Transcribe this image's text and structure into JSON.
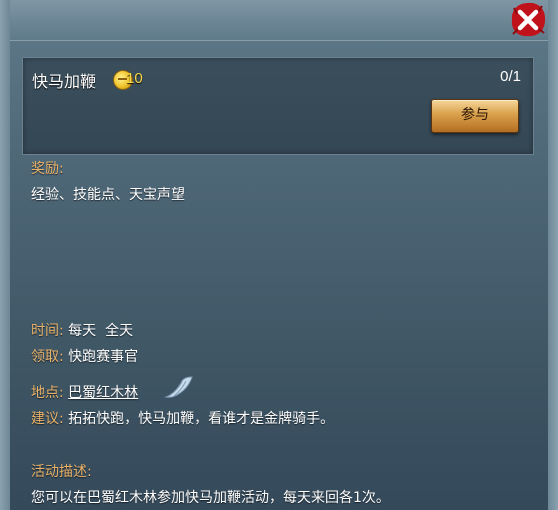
{
  "window": {
    "close_icon": "close-x-icon"
  },
  "quest": {
    "title": "快马加鞭",
    "reward_icon": "coin-icon",
    "reward_count": "10",
    "progress": "0/1",
    "join_label": "参与"
  },
  "reward": {
    "label": "奖励:",
    "items": "经验、技能点、天宝声望"
  },
  "info": {
    "time_label": "时间:",
    "time_value": "每天  全天",
    "receive_label": "领取:",
    "receive_value": "快跑赛事官",
    "location_label": "地点:",
    "location_value": "巴蜀红木林",
    "location_icon": "wing-travel-icon",
    "advice_label": "建议:",
    "advice_value": "拓拓快跑，快马加鞭，看谁才是金牌骑手。"
  },
  "description": {
    "label": "活动描述:",
    "text": "您可以在巴蜀红木林参加快马加鞭活动，每天来回各1次。"
  },
  "colors": {
    "label": "#e8b26a",
    "reward": "#f8d84a",
    "close": "#c0121a"
  }
}
